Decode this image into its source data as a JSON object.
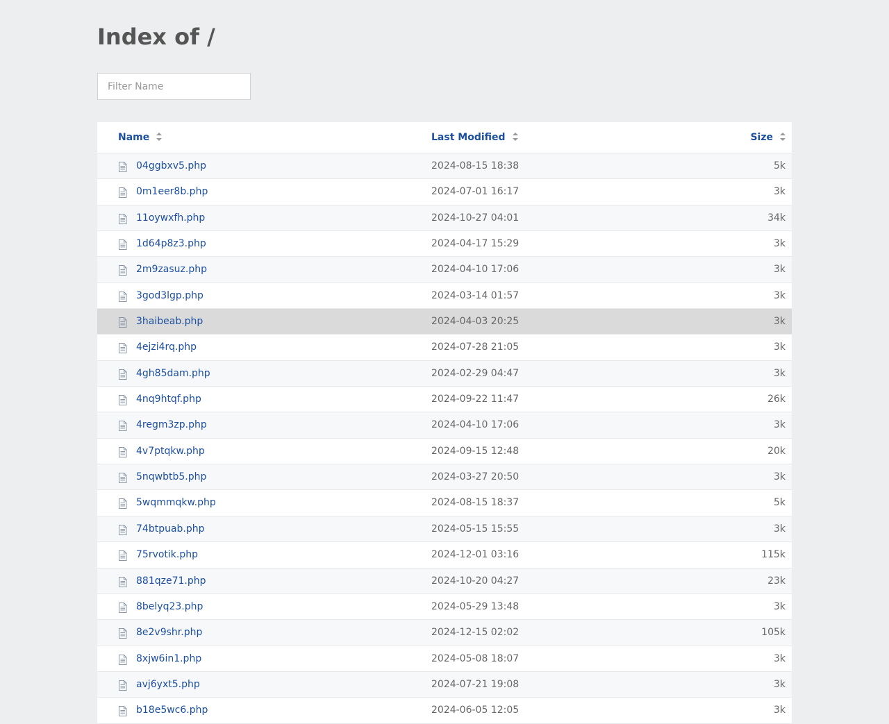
{
  "page": {
    "title": "Index of /"
  },
  "filter": {
    "placeholder": "Filter Name",
    "value": ""
  },
  "columns": {
    "name": "Name",
    "modified": "Last Modified",
    "size": "Size"
  },
  "colors": {
    "link": "#1c4fa0",
    "background": "#eceef0",
    "highlight": "#dadada"
  },
  "rows": [
    {
      "name": "04ggbxv5.php",
      "modified": "2024-08-15 18:38",
      "size": "5k"
    },
    {
      "name": "0m1eer8b.php",
      "modified": "2024-07-01 16:17",
      "size": "3k"
    },
    {
      "name": "11oywxfh.php",
      "modified": "2024-10-27 04:01",
      "size": "34k"
    },
    {
      "name": "1d64p8z3.php",
      "modified": "2024-04-17 15:29",
      "size": "3k"
    },
    {
      "name": "2m9zasuz.php",
      "modified": "2024-04-10 17:06",
      "size": "3k"
    },
    {
      "name": "3god3lgp.php",
      "modified": "2024-03-14 01:57",
      "size": "3k"
    },
    {
      "name": "3haibeab.php",
      "modified": "2024-04-03 20:25",
      "size": "3k",
      "highlighted": true
    },
    {
      "name": "4ejzi4rq.php",
      "modified": "2024-07-28 21:05",
      "size": "3k"
    },
    {
      "name": "4gh85dam.php",
      "modified": "2024-02-29 04:47",
      "size": "3k"
    },
    {
      "name": "4nq9htqf.php",
      "modified": "2024-09-22 11:47",
      "size": "26k"
    },
    {
      "name": "4regm3zp.php",
      "modified": "2024-04-10 17:06",
      "size": "3k"
    },
    {
      "name": "4v7ptqkw.php",
      "modified": "2024-09-15 12:48",
      "size": "20k"
    },
    {
      "name": "5nqwbtb5.php",
      "modified": "2024-03-27 20:50",
      "size": "3k"
    },
    {
      "name": "5wqmmqkw.php",
      "modified": "2024-08-15 18:37",
      "size": "5k"
    },
    {
      "name": "74btpuab.php",
      "modified": "2024-05-15 15:55",
      "size": "3k"
    },
    {
      "name": "75rvotik.php",
      "modified": "2024-12-01 03:16",
      "size": "115k"
    },
    {
      "name": "881qze71.php",
      "modified": "2024-10-20 04:27",
      "size": "23k"
    },
    {
      "name": "8belyq23.php",
      "modified": "2024-05-29 13:48",
      "size": "3k"
    },
    {
      "name": "8e2v9shr.php",
      "modified": "2024-12-15 02:02",
      "size": "105k"
    },
    {
      "name": "8xjw6in1.php",
      "modified": "2024-05-08 18:07",
      "size": "3k"
    },
    {
      "name": "avj6yxt5.php",
      "modified": "2024-07-21 19:08",
      "size": "3k"
    },
    {
      "name": "b18e5wc6.php",
      "modified": "2024-06-05 12:05",
      "size": "3k"
    }
  ]
}
